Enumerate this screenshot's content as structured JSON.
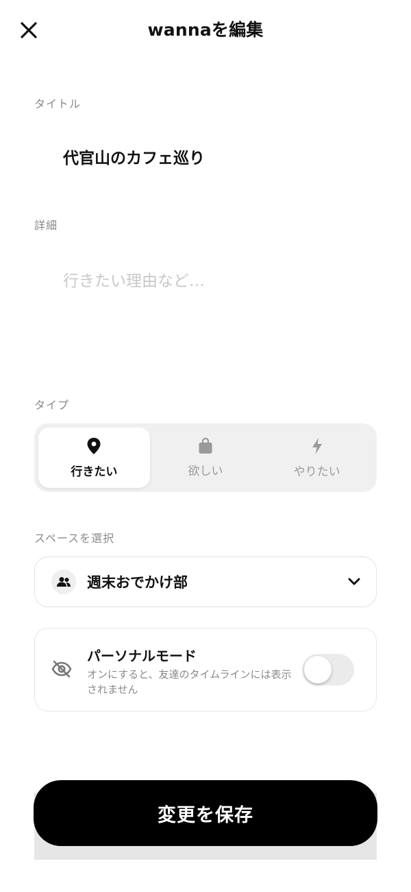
{
  "header": {
    "title": "wannaを編集"
  },
  "form": {
    "title_label": "タイトル",
    "title_value": "代官山のカフェ巡り",
    "detail_label": "詳細",
    "detail_placeholder": "行きたい理由など…",
    "type_label": "タイプ",
    "type_options": [
      {
        "label": "行きたい",
        "icon": "location-pin-icon",
        "selected": true
      },
      {
        "label": "欲しい",
        "icon": "shopping-bag-icon",
        "selected": false
      },
      {
        "label": "やりたい",
        "icon": "lightning-bolt-icon",
        "selected": false
      }
    ],
    "space_label": "スペースを選択",
    "space_selected": "週末おでかけ部",
    "personal_mode": {
      "title": "パーソナルモード",
      "description": "オンにすると、友達のタイムラインには表示されません",
      "enabled": false
    }
  },
  "save_button": {
    "label": "変更を保存"
  },
  "colors": {
    "primary": "#000000",
    "muted": "#8a8a8a",
    "segment_bg": "#f0f0f0",
    "toggle_off": "#ebebeb"
  }
}
